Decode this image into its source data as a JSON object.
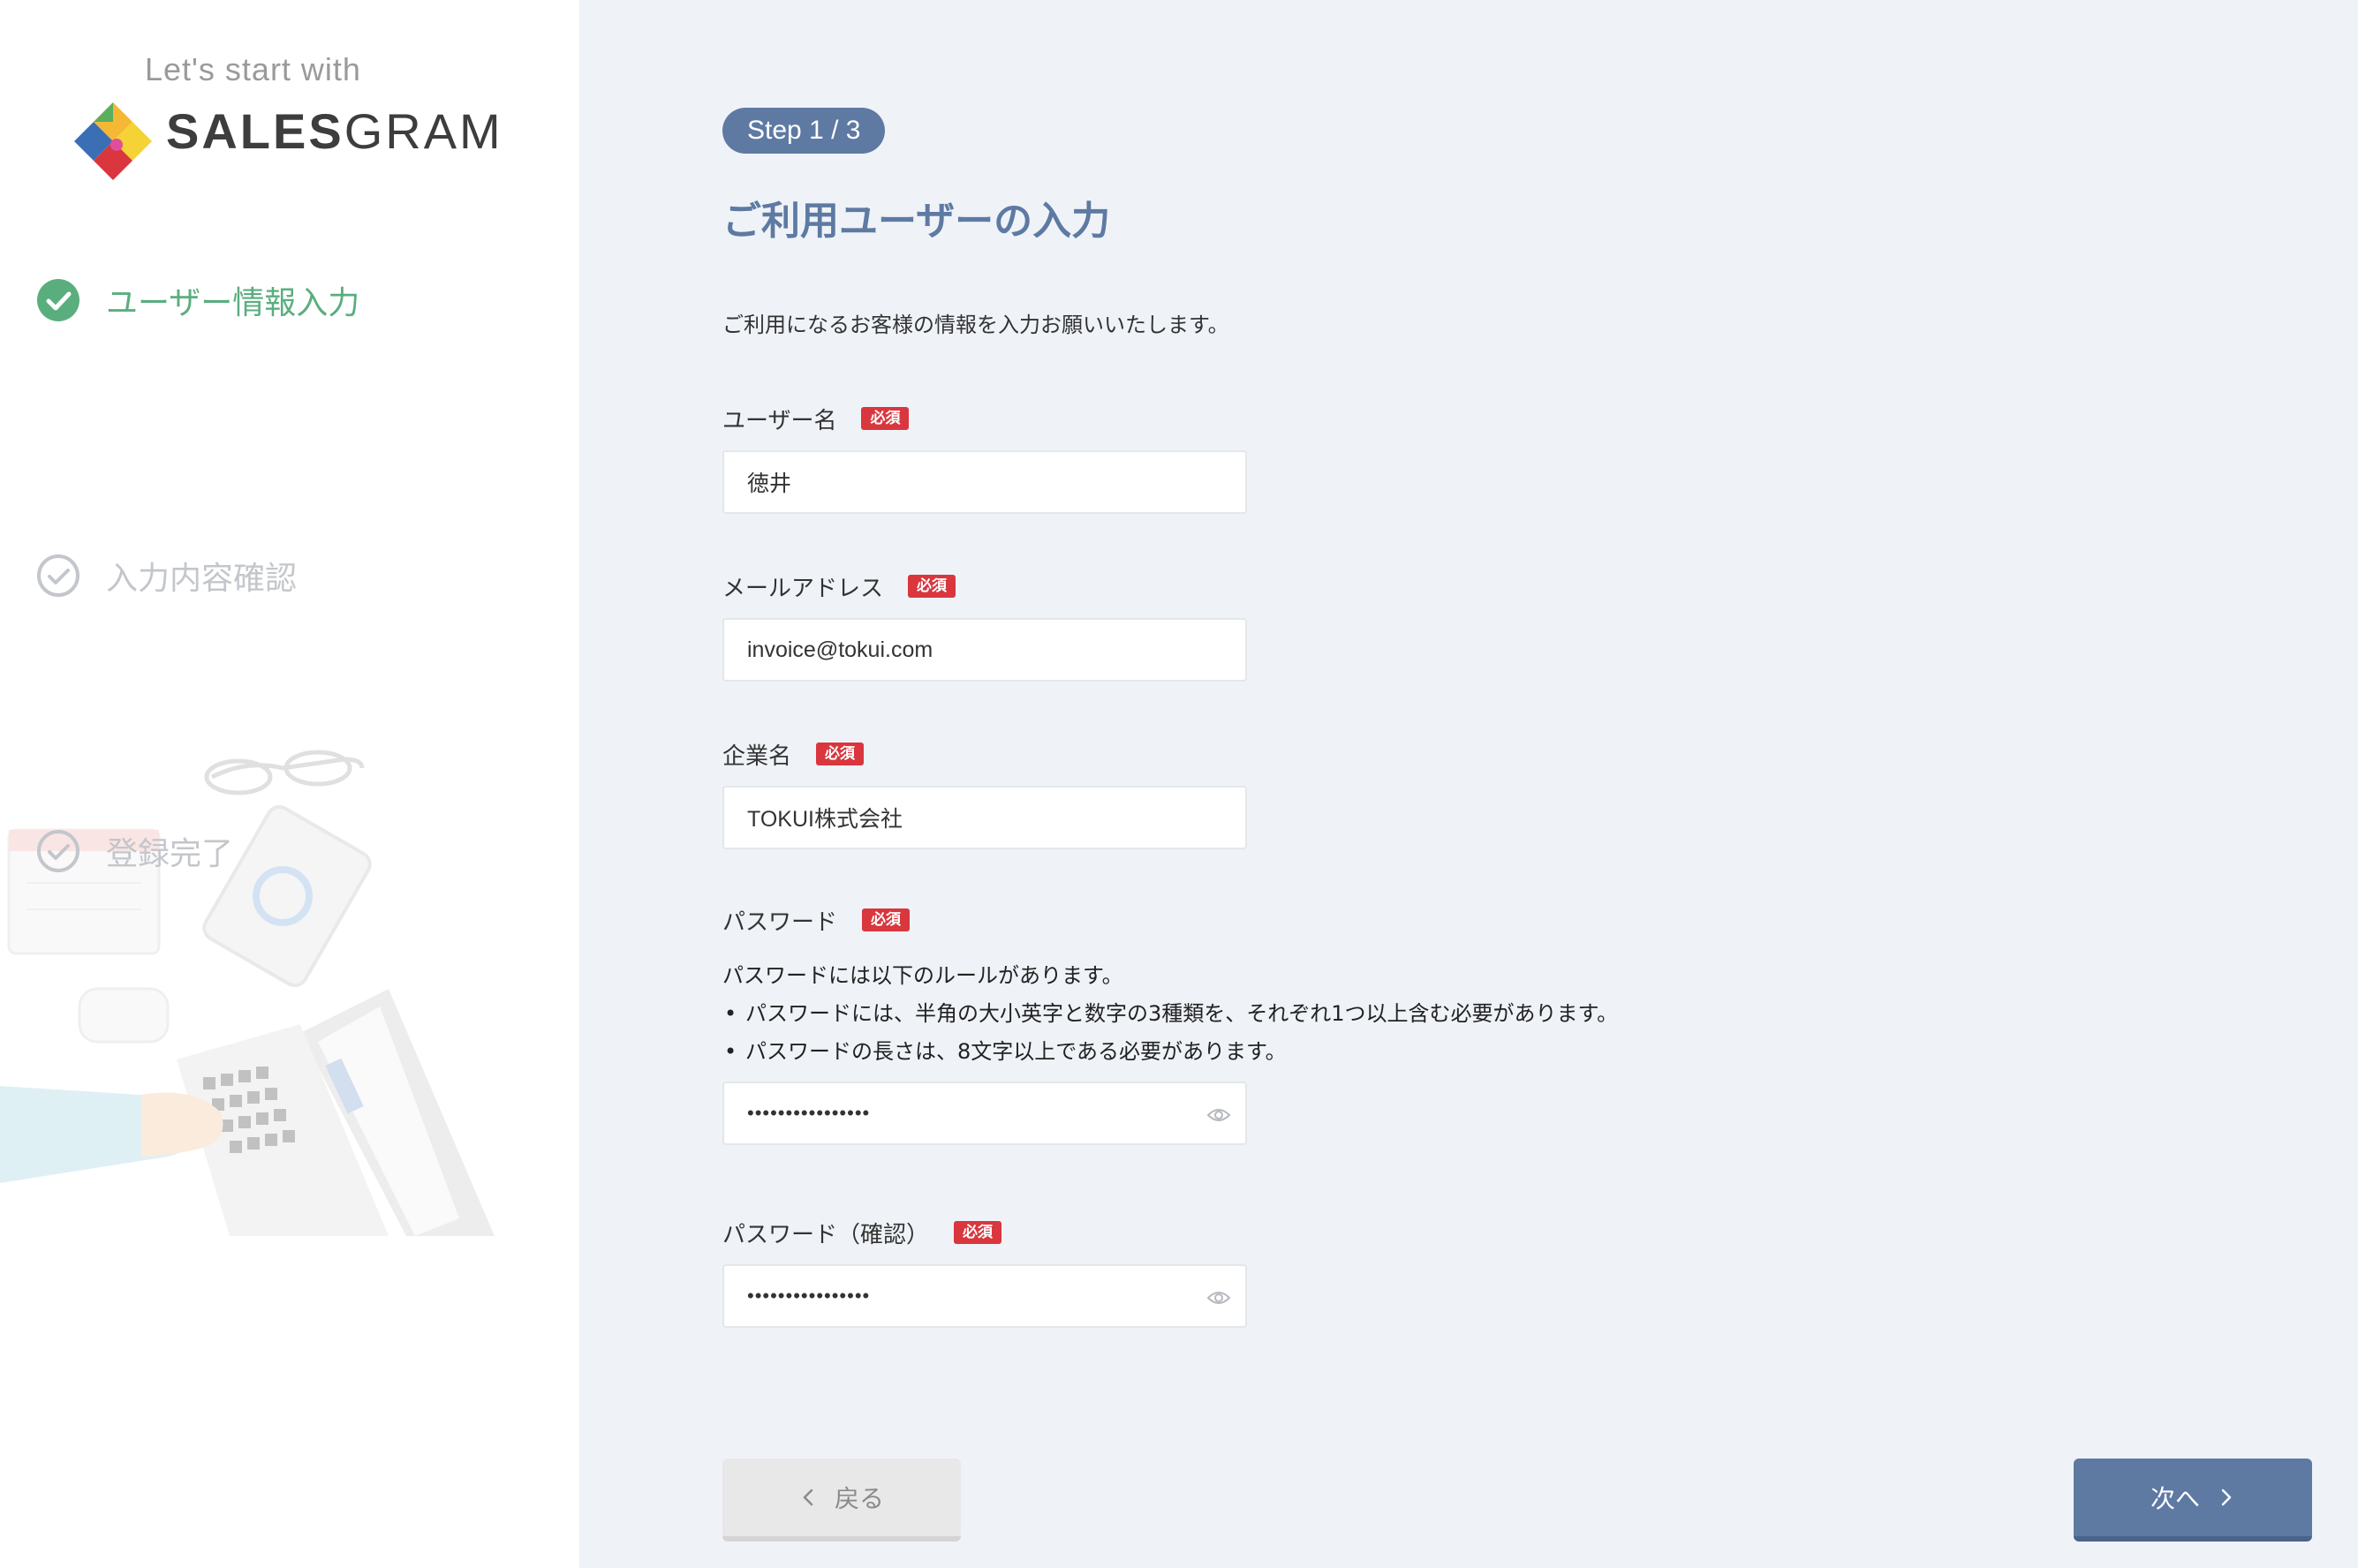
{
  "sidebar": {
    "tagline": "Let's start with",
    "brand_bold": "SALES",
    "brand_light": "GRAM",
    "steps": [
      {
        "label": "ユーザー情報入力",
        "state": "active"
      },
      {
        "label": "入力内容確認",
        "state": "inactive"
      },
      {
        "label": "登録完了",
        "state": "inactive"
      }
    ]
  },
  "main": {
    "step_badge": "Step 1 / 3",
    "title": "ご利用ユーザーの入力",
    "description": "ご利用になるお客様の情報を入力お願いいたします。",
    "required_label": "必須",
    "fields": {
      "username": {
        "label": "ユーザー名",
        "value": "徳井"
      },
      "email": {
        "label": "メールアドレス",
        "value": "invoice@tokui.com"
      },
      "company": {
        "label": "企業名",
        "value": "TOKUI株式会社"
      },
      "password": {
        "label": "パスワード",
        "value": "••••••••••••••••",
        "rules_intro": "パスワードには以下のルールがあります。",
        "rules": [
          "パスワードには、半角の大小英字と数字の3種類を、それぞれ1つ以上含む必要があります。",
          "パスワードの長さは、8文字以上である必要があります。"
        ]
      },
      "password_confirm": {
        "label": "パスワード（確認）",
        "value": "••••••••••••••••"
      }
    },
    "back_label": "戻る",
    "next_label": "次へ"
  },
  "colors": {
    "accent": "#5e7aa3",
    "active_step": "#5aae7e",
    "inactive_step": "#c3c6cb",
    "required": "#d9363e",
    "background": "#eff3f8"
  },
  "icons": [
    "check-circle-icon",
    "eye-icon",
    "chevron-left-icon",
    "chevron-right-icon",
    "salesgram-logo"
  ]
}
